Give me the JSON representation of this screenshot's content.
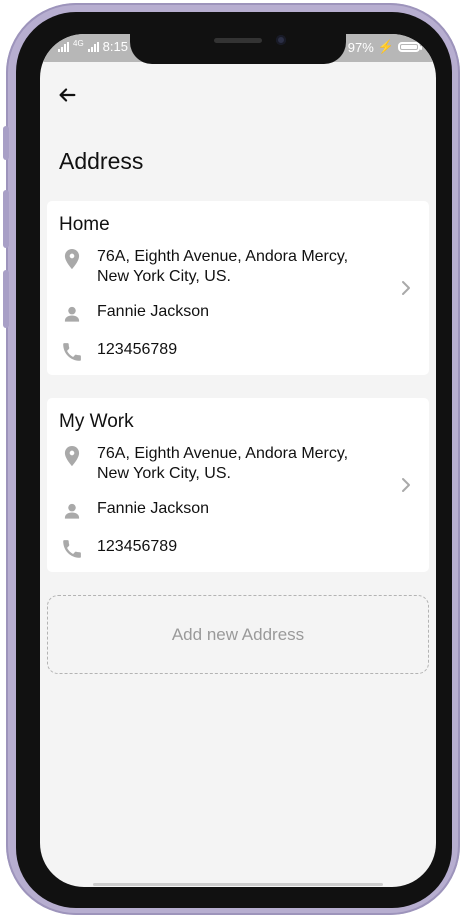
{
  "status_bar": {
    "network": "4G",
    "time": "8:15",
    "battery_percent": "97%",
    "battery_level": 0.97,
    "charging_icon": "lightning-icon"
  },
  "header": {
    "back_icon": "back-arrow-icon",
    "title": "Address"
  },
  "addresses": [
    {
      "label": "Home",
      "address": "76A, Eighth Avenue, Andora Mercy,\nNew York City, US.",
      "name": "Fannie Jackson",
      "phone": "123456789",
      "icons": {
        "location": "location-pin-icon",
        "person": "person-icon",
        "phone": "phone-icon",
        "chevron": "chevron-right-icon"
      }
    },
    {
      "label": "My Work",
      "address": "76A, Eighth Avenue, Andora Mercy,\nNew York City, US.",
      "name": "Fannie Jackson",
      "phone": "123456789",
      "icons": {
        "location": "location-pin-icon",
        "person": "person-icon",
        "phone": "phone-icon",
        "chevron": "chevron-right-icon"
      }
    }
  ],
  "actions": {
    "add_new_address": "Add new Address"
  },
  "colors": {
    "screen_background": "#f4f4f4",
    "card_background": "#ffffff",
    "icon_gray": "#a9a9a9",
    "muted_text": "#9a9a9a",
    "status_bar": "#b7b7b7",
    "phone_frame": "#b7aed0"
  }
}
